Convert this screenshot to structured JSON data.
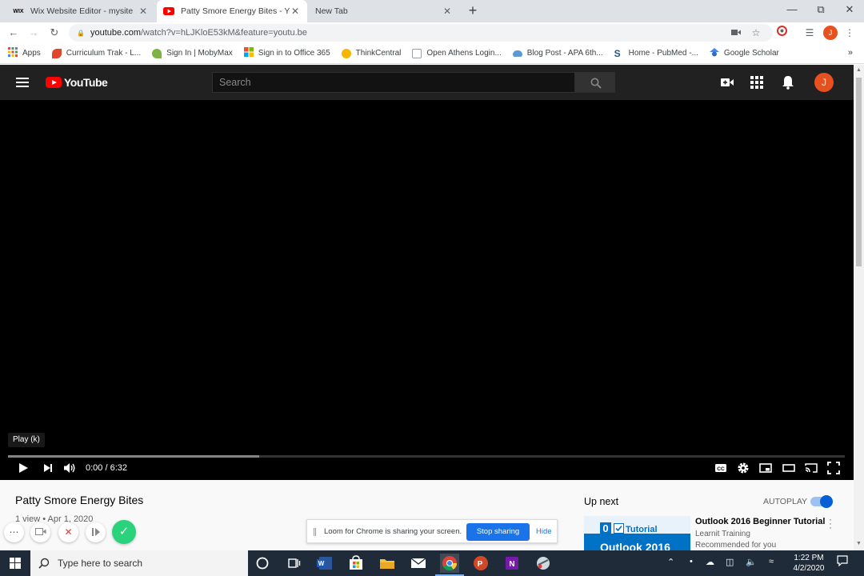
{
  "browser": {
    "tabs": [
      {
        "title": "Wix Website Editor - mysite",
        "favicon": "wix-logo"
      },
      {
        "title": "Patty Smore Energy Bites - YouTu",
        "favicon": "youtube-logo"
      },
      {
        "title": "New Tab",
        "favicon": ""
      }
    ],
    "url_host": "youtube.com",
    "url_rest": "/watch?v=hLJKloE53kM&feature=youtu.be",
    "profile_initial": "J",
    "bookmarks": [
      {
        "label": "Apps",
        "icon": "apps-grid-icon",
        "color": "#e8453c"
      },
      {
        "label": "Curriculum Trak - L...",
        "icon": "curriculum-trak-icon",
        "color": "#e0452d"
      },
      {
        "label": "Sign In | MobyMax",
        "icon": "mobymax-icon",
        "color": "#7cb342"
      },
      {
        "label": "Sign in to Office 365",
        "icon": "office-icon",
        "color": "#f25022"
      },
      {
        "label": "ThinkCentral",
        "icon": "thinkcentral-icon",
        "color": "#f7b500"
      },
      {
        "label": "Open Athens Login...",
        "icon": "document-icon",
        "color": "#9aa0a6"
      },
      {
        "label": "Blog Post - APA 6th...",
        "icon": "cloud-icon",
        "color": "#5b9bd5"
      },
      {
        "label": "Home - PubMed -...",
        "icon": "pubmed-icon",
        "color": "#20558a"
      },
      {
        "label": "Google Scholar",
        "icon": "scholar-icon",
        "color": "#4285f4"
      }
    ]
  },
  "youtube": {
    "logo_text": "YouTube",
    "search_placeholder": "Search",
    "avatar_initial": "J",
    "player": {
      "tooltip": "Play (k)",
      "time": "0:00 / 6:32",
      "buffered_fraction": 0.3
    },
    "video": {
      "title": "Patty Smore Energy Bites",
      "meta": "1 view • Apr 1, 2020"
    },
    "up_next": {
      "heading": "Up next",
      "autoplay_label": "AUTOPLAY",
      "autoplay_on": true,
      "video_title": "Outlook 2016 Beginner Tutorial",
      "channel": "Learnit Training",
      "reason": "Recommended for you",
      "thumbnail_number": "0",
      "thumbnail_word": "Tutorial",
      "thumbnail_big": "Outlook 2016"
    }
  },
  "loom": {
    "message": "Loom for Chrome is sharing your screen.",
    "stop_label": "Stop sharing",
    "hide_label": "Hide"
  },
  "taskbar": {
    "search_placeholder": "Type here to search",
    "time": "1:22 PM",
    "date": "4/2/2020"
  },
  "colors": {
    "youtube_red": "#ff0000",
    "yt_dark": "#212121",
    "chrome_blue": "#1a73e8",
    "loom_green": "#2bd27c"
  }
}
